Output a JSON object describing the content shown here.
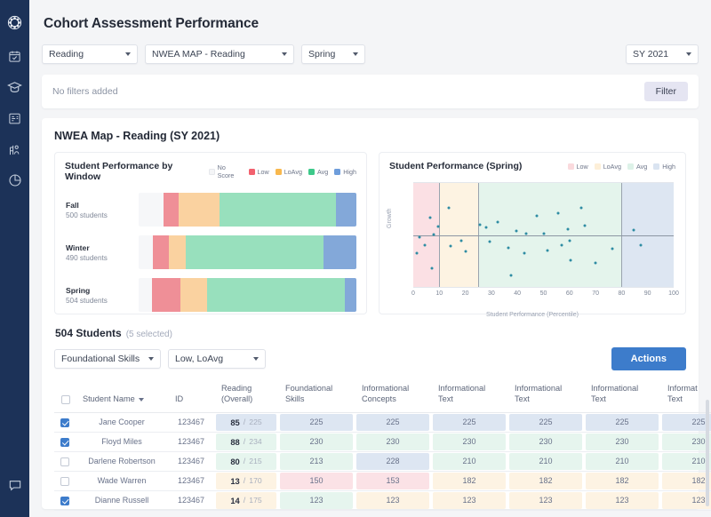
{
  "sidebar": {
    "items": [
      {
        "name": "logo-icon",
        "label": "logo"
      },
      {
        "name": "calendar-check-icon",
        "label": "Attendance"
      },
      {
        "name": "graduation-cap-icon",
        "label": "Academics"
      },
      {
        "name": "gradebook-icon",
        "label": "Gradebook"
      },
      {
        "name": "roster-icon",
        "label": "Roster"
      },
      {
        "name": "pie-chart-icon",
        "label": "Reports"
      }
    ],
    "bottom": {
      "name": "chat-icon",
      "label": "Messages"
    }
  },
  "header": {
    "title": "Cohort Assessment Performance",
    "subject_select": "Reading",
    "assessment_select": "NWEA MAP - Reading",
    "term_select": "Spring",
    "year_select": "SY 2021"
  },
  "filter_bar": {
    "empty_text": "No filters added",
    "filter_button": "Filter"
  },
  "card": {
    "title": "NWEA Map - Reading (SY 2021)"
  },
  "chart_data": [
    {
      "type": "bar",
      "title": "Student Performance by Window",
      "orientation": "horizontal-stacked",
      "legend": [
        {
          "label": "No Score",
          "color": "#f4f5f7"
        },
        {
          "label": "Low",
          "color": "#f2616e"
        },
        {
          "label": "LoAvg",
          "color": "#f8b84e"
        },
        {
          "label": "Avg",
          "color": "#3dc98a"
        },
        {
          "label": "High",
          "color": "#6e9ddb"
        }
      ],
      "series_colors": [
        "#f6f7f9",
        "#ef8f97",
        "#fad2a0",
        "#98e0bd",
        "#83a8d9"
      ],
      "categories": [
        "Fall",
        "Winter",
        "Spring"
      ],
      "sublabels": [
        "500 students",
        "490 students",
        "504 students"
      ],
      "rows": [
        {
          "category": "Fall",
          "sublabel": "500 students",
          "values": [
            11.5,
            7.0,
            18.5,
            53.5,
            9.5
          ]
        },
        {
          "category": "Winter",
          "sublabel": "490 students",
          "values": [
            6.5,
            7.5,
            7.5,
            63.5,
            15.0
          ]
        },
        {
          "category": "Spring",
          "sublabel": "504 students",
          "values": [
            6.0,
            13.0,
            12.5,
            63.0,
            5.5
          ]
        }
      ]
    },
    {
      "type": "scatter",
      "title": "Student Performance (Spring)",
      "xlabel": "Student Performance (Percentile)",
      "ylabel": "Growth",
      "xlim": [
        0,
        100
      ],
      "ylim": [
        -15,
        15
      ],
      "xticks": [
        0,
        10,
        20,
        30,
        40,
        50,
        60,
        70,
        80,
        90,
        100
      ],
      "yticks": [
        15,
        10,
        5,
        0,
        -5,
        -10,
        -15
      ],
      "legend": [
        {
          "label": "Low",
          "color": "#fadadd"
        },
        {
          "label": "LoAvg",
          "color": "#fdefd8"
        },
        {
          "label": "Avg",
          "color": "#ddf2e8"
        },
        {
          "label": "High",
          "color": "#dae4f1"
        }
      ],
      "bands": [
        {
          "label": "Low",
          "from": 0,
          "to": 10,
          "color": "#fbe0e4"
        },
        {
          "label": "LoAvg",
          "from": 10,
          "to": 25,
          "color": "#fdf3e2"
        },
        {
          "label": "Avg",
          "from": 25,
          "to": 80,
          "color": "#e4f4ec"
        },
        {
          "label": "High",
          "from": 80,
          "to": 100,
          "color": "#dde6f2"
        }
      ],
      "point_color": "#2e8ca3",
      "points": [
        {
          "x": 1.5,
          "y": -5.3
        },
        {
          "x": 2.5,
          "y": -0.7
        },
        {
          "x": 4.5,
          "y": -2.9
        },
        {
          "x": 6.5,
          "y": 5.1
        },
        {
          "x": 7.0,
          "y": -9.7
        },
        {
          "x": 7.8,
          "y": 0.1
        },
        {
          "x": 9.5,
          "y": 2.4
        },
        {
          "x": 13.5,
          "y": 7.7
        },
        {
          "x": 14.5,
          "y": -3.3
        },
        {
          "x": 18.5,
          "y": -1.6
        },
        {
          "x": 20.0,
          "y": -4.8
        },
        {
          "x": 25.5,
          "y": 3.0
        },
        {
          "x": 28.0,
          "y": 2.2
        },
        {
          "x": 29.5,
          "y": -1.8
        },
        {
          "x": 32.5,
          "y": 3.7
        },
        {
          "x": 36.5,
          "y": -3.6
        },
        {
          "x": 37.5,
          "y": -11.7
        },
        {
          "x": 39.5,
          "y": 1.1
        },
        {
          "x": 42.5,
          "y": -5.2
        },
        {
          "x": 43.5,
          "y": 0.4
        },
        {
          "x": 47.5,
          "y": 5.4
        },
        {
          "x": 50.0,
          "y": 0.4
        },
        {
          "x": 51.5,
          "y": -4.5
        },
        {
          "x": 55.5,
          "y": 6.2
        },
        {
          "x": 57.0,
          "y": -2.9
        },
        {
          "x": 59.5,
          "y": 1.7
        },
        {
          "x": 60.0,
          "y": -1.7
        },
        {
          "x": 60.5,
          "y": -7.4
        },
        {
          "x": 64.5,
          "y": 7.9
        },
        {
          "x": 66.0,
          "y": 2.8
        },
        {
          "x": 70.0,
          "y": -8.1
        },
        {
          "x": 76.5,
          "y": -4.0
        },
        {
          "x": 84.5,
          "y": 1.5
        },
        {
          "x": 87.5,
          "y": -2.9
        }
      ]
    }
  ],
  "students": {
    "count_label": "504 Students",
    "selected_label": "(5 selected)",
    "skill_select": "Foundational Skills",
    "level_select": "Low, LoAvg",
    "actions_button": "Actions",
    "columns": [
      "Student Name",
      "ID",
      "Reading\n(Overall)",
      "Foundational\nSkills",
      "Informational\nConcepts",
      "Informational\nText",
      "Informational\nText",
      "Informational\nText",
      "Informat\nText"
    ],
    "rows": [
      {
        "selected": true,
        "name": "Jane Cooper",
        "id": "123467",
        "score": "85",
        "score_total": "225",
        "score_tone": "high",
        "cells": [
          {
            "v": "225",
            "tone": "high"
          },
          {
            "v": "225",
            "tone": "high"
          },
          {
            "v": "225",
            "tone": "high"
          },
          {
            "v": "225",
            "tone": "high"
          },
          {
            "v": "225",
            "tone": "high"
          },
          {
            "v": "225",
            "tone": "high"
          }
        ]
      },
      {
        "selected": true,
        "name": "Floyd Miles",
        "id": "123467",
        "score": "88",
        "score_total": "234",
        "score_tone": "avg",
        "cells": [
          {
            "v": "230",
            "tone": "avg"
          },
          {
            "v": "230",
            "tone": "avg"
          },
          {
            "v": "230",
            "tone": "avg"
          },
          {
            "v": "230",
            "tone": "avg"
          },
          {
            "v": "230",
            "tone": "avg"
          },
          {
            "v": "230",
            "tone": "avg"
          }
        ]
      },
      {
        "selected": false,
        "name": "Darlene Robertson",
        "id": "123467",
        "score": "80",
        "score_total": "215",
        "score_tone": "avg",
        "cells": [
          {
            "v": "213",
            "tone": "avg"
          },
          {
            "v": "228",
            "tone": "high"
          },
          {
            "v": "210",
            "tone": "avg"
          },
          {
            "v": "210",
            "tone": "avg"
          },
          {
            "v": "210",
            "tone": "avg"
          },
          {
            "v": "210",
            "tone": "avg"
          }
        ]
      },
      {
        "selected": false,
        "name": "Wade Warren",
        "id": "123467",
        "score": "13",
        "score_total": "170",
        "score_tone": "loavg",
        "cells": [
          {
            "v": "150",
            "tone": "low"
          },
          {
            "v": "153",
            "tone": "low"
          },
          {
            "v": "182",
            "tone": "loavg"
          },
          {
            "v": "182",
            "tone": "loavg"
          },
          {
            "v": "182",
            "tone": "loavg"
          },
          {
            "v": "182",
            "tone": "loavg"
          }
        ]
      },
      {
        "selected": true,
        "name": "Dianne Russell",
        "id": "123467",
        "score": "14",
        "score_total": "175",
        "score_tone": "loavg",
        "cells": [
          {
            "v": "123",
            "tone": "avg"
          },
          {
            "v": "123",
            "tone": "loavg"
          },
          {
            "v": "123",
            "tone": "loavg"
          },
          {
            "v": "123",
            "tone": "loavg"
          },
          {
            "v": "123",
            "tone": "loavg"
          },
          {
            "v": "123",
            "tone": "loavg"
          }
        ]
      }
    ],
    "tone_colors": {
      "low": "#fbe2e6",
      "loavg": "#fdf3e3",
      "avg": "#e6f5ee",
      "high": "#dde6f2",
      "none": "#ffffff"
    }
  }
}
